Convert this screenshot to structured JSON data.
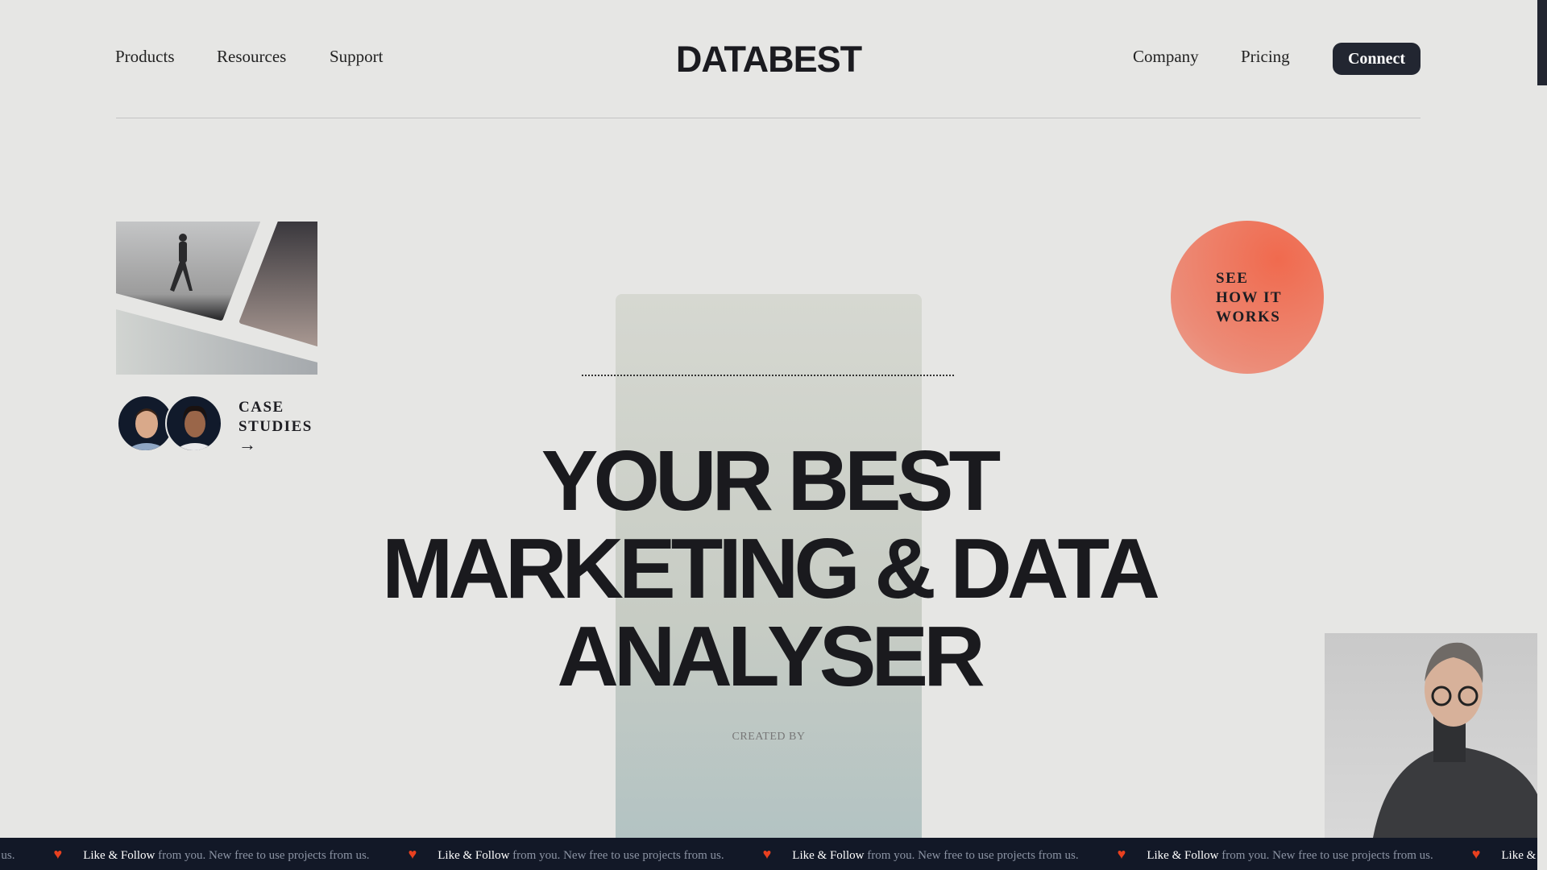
{
  "nav": {
    "left": [
      "Products",
      "Resources",
      "Support"
    ],
    "logo": "DATABEST",
    "right": [
      "Company",
      "Pricing"
    ],
    "connect": "Connect"
  },
  "hero": {
    "headline": [
      "YOUR BEST",
      "MARKETING & DATA",
      "ANALYSER"
    ],
    "created_by": "CREATED BY"
  },
  "cta_circle": {
    "lines": [
      "SEE",
      "HOW IT",
      "WORKS"
    ],
    "color": "#f06a4e"
  },
  "case_studies": {
    "lines": [
      "CASE",
      "STUDIES"
    ],
    "arrow": "→"
  },
  "ticker": {
    "bold": "Like & Follow",
    "text": " from you. New free to use projects from us.",
    "lead": "m us.",
    "icon": "heart-icon",
    "heart_color": "#e8401f"
  },
  "colors": {
    "button": "#222631",
    "ticker_bg": "#121827",
    "background": "#e6e6e4"
  }
}
